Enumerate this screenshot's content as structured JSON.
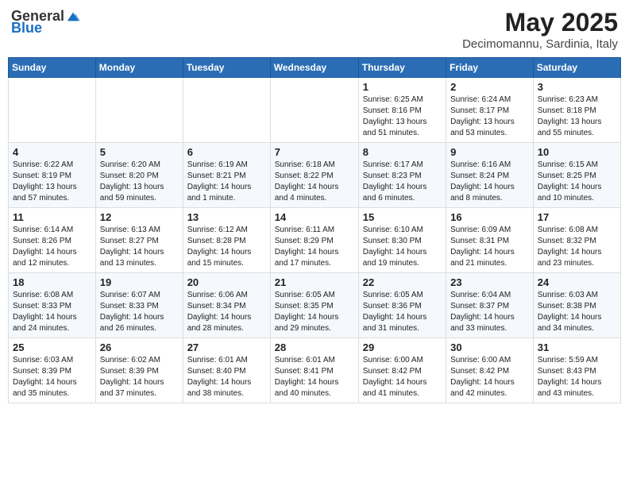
{
  "header": {
    "logo_general": "General",
    "logo_blue": "Blue",
    "month_year": "May 2025",
    "location": "Decimomannu, Sardinia, Italy"
  },
  "weekdays": [
    "Sunday",
    "Monday",
    "Tuesday",
    "Wednesday",
    "Thursday",
    "Friday",
    "Saturday"
  ],
  "weeks": [
    [
      {
        "day": "",
        "text": ""
      },
      {
        "day": "",
        "text": ""
      },
      {
        "day": "",
        "text": ""
      },
      {
        "day": "",
        "text": ""
      },
      {
        "day": "1",
        "text": "Sunrise: 6:25 AM\nSunset: 8:16 PM\nDaylight: 13 hours\nand 51 minutes."
      },
      {
        "day": "2",
        "text": "Sunrise: 6:24 AM\nSunset: 8:17 PM\nDaylight: 13 hours\nand 53 minutes."
      },
      {
        "day": "3",
        "text": "Sunrise: 6:23 AM\nSunset: 8:18 PM\nDaylight: 13 hours\nand 55 minutes."
      }
    ],
    [
      {
        "day": "4",
        "text": "Sunrise: 6:22 AM\nSunset: 8:19 PM\nDaylight: 13 hours\nand 57 minutes."
      },
      {
        "day": "5",
        "text": "Sunrise: 6:20 AM\nSunset: 8:20 PM\nDaylight: 13 hours\nand 59 minutes."
      },
      {
        "day": "6",
        "text": "Sunrise: 6:19 AM\nSunset: 8:21 PM\nDaylight: 14 hours\nand 1 minute."
      },
      {
        "day": "7",
        "text": "Sunrise: 6:18 AM\nSunset: 8:22 PM\nDaylight: 14 hours\nand 4 minutes."
      },
      {
        "day": "8",
        "text": "Sunrise: 6:17 AM\nSunset: 8:23 PM\nDaylight: 14 hours\nand 6 minutes."
      },
      {
        "day": "9",
        "text": "Sunrise: 6:16 AM\nSunset: 8:24 PM\nDaylight: 14 hours\nand 8 minutes."
      },
      {
        "day": "10",
        "text": "Sunrise: 6:15 AM\nSunset: 8:25 PM\nDaylight: 14 hours\nand 10 minutes."
      }
    ],
    [
      {
        "day": "11",
        "text": "Sunrise: 6:14 AM\nSunset: 8:26 PM\nDaylight: 14 hours\nand 12 minutes."
      },
      {
        "day": "12",
        "text": "Sunrise: 6:13 AM\nSunset: 8:27 PM\nDaylight: 14 hours\nand 13 minutes."
      },
      {
        "day": "13",
        "text": "Sunrise: 6:12 AM\nSunset: 8:28 PM\nDaylight: 14 hours\nand 15 minutes."
      },
      {
        "day": "14",
        "text": "Sunrise: 6:11 AM\nSunset: 8:29 PM\nDaylight: 14 hours\nand 17 minutes."
      },
      {
        "day": "15",
        "text": "Sunrise: 6:10 AM\nSunset: 8:30 PM\nDaylight: 14 hours\nand 19 minutes."
      },
      {
        "day": "16",
        "text": "Sunrise: 6:09 AM\nSunset: 8:31 PM\nDaylight: 14 hours\nand 21 minutes."
      },
      {
        "day": "17",
        "text": "Sunrise: 6:08 AM\nSunset: 8:32 PM\nDaylight: 14 hours\nand 23 minutes."
      }
    ],
    [
      {
        "day": "18",
        "text": "Sunrise: 6:08 AM\nSunset: 8:33 PM\nDaylight: 14 hours\nand 24 minutes."
      },
      {
        "day": "19",
        "text": "Sunrise: 6:07 AM\nSunset: 8:33 PM\nDaylight: 14 hours\nand 26 minutes."
      },
      {
        "day": "20",
        "text": "Sunrise: 6:06 AM\nSunset: 8:34 PM\nDaylight: 14 hours\nand 28 minutes."
      },
      {
        "day": "21",
        "text": "Sunrise: 6:05 AM\nSunset: 8:35 PM\nDaylight: 14 hours\nand 29 minutes."
      },
      {
        "day": "22",
        "text": "Sunrise: 6:05 AM\nSunset: 8:36 PM\nDaylight: 14 hours\nand 31 minutes."
      },
      {
        "day": "23",
        "text": "Sunrise: 6:04 AM\nSunset: 8:37 PM\nDaylight: 14 hours\nand 33 minutes."
      },
      {
        "day": "24",
        "text": "Sunrise: 6:03 AM\nSunset: 8:38 PM\nDaylight: 14 hours\nand 34 minutes."
      }
    ],
    [
      {
        "day": "25",
        "text": "Sunrise: 6:03 AM\nSunset: 8:39 PM\nDaylight: 14 hours\nand 35 minutes."
      },
      {
        "day": "26",
        "text": "Sunrise: 6:02 AM\nSunset: 8:39 PM\nDaylight: 14 hours\nand 37 minutes."
      },
      {
        "day": "27",
        "text": "Sunrise: 6:01 AM\nSunset: 8:40 PM\nDaylight: 14 hours\nand 38 minutes."
      },
      {
        "day": "28",
        "text": "Sunrise: 6:01 AM\nSunset: 8:41 PM\nDaylight: 14 hours\nand 40 minutes."
      },
      {
        "day": "29",
        "text": "Sunrise: 6:00 AM\nSunset: 8:42 PM\nDaylight: 14 hours\nand 41 minutes."
      },
      {
        "day": "30",
        "text": "Sunrise: 6:00 AM\nSunset: 8:42 PM\nDaylight: 14 hours\nand 42 minutes."
      },
      {
        "day": "31",
        "text": "Sunrise: 5:59 AM\nSunset: 8:43 PM\nDaylight: 14 hours\nand 43 minutes."
      }
    ]
  ]
}
